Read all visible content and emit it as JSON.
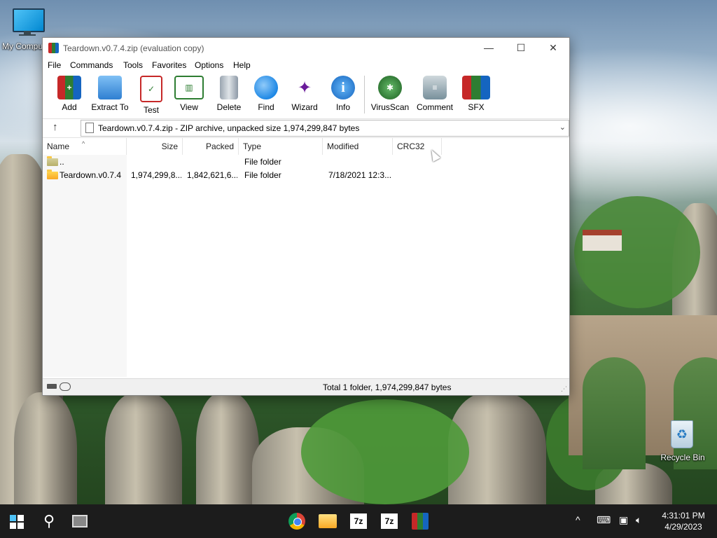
{
  "desktop": {
    "icons": [
      {
        "label": "My Compu"
      },
      {
        "label": "Recycle Bin"
      }
    ]
  },
  "window": {
    "title": "Teardown.v0.7.4.zip (evaluation copy)",
    "controls": {
      "minimize": "—",
      "maximize": "☐",
      "close": "✕"
    },
    "menu": [
      "File",
      "Commands",
      "Tools",
      "Favorites",
      "Options",
      "Help"
    ],
    "toolbar": [
      {
        "label": "Add",
        "icon": "add-archive-icon",
        "color": "#b71c1c"
      },
      {
        "label": "Extract To",
        "icon": "extract-folder-icon",
        "color": "#2f7fd1"
      },
      {
        "label": "Test",
        "icon": "test-checklist-icon",
        "color": "#c62828"
      },
      {
        "label": "View",
        "icon": "view-book-icon",
        "color": "#2e7d32"
      },
      {
        "label": "Delete",
        "icon": "trash-icon",
        "color": "#8d99a6"
      },
      {
        "label": "Find",
        "icon": "magnifier-icon",
        "color": "#1e88e5"
      },
      {
        "label": "Wizard",
        "icon": "magic-wand-icon",
        "color": "#7e57c2"
      },
      {
        "label": "Info",
        "icon": "info-icon",
        "color": "#1565c0"
      },
      {
        "label": "VirusScan",
        "icon": "virus-scan-icon",
        "color": "#2e7d32"
      },
      {
        "label": "Comment",
        "icon": "comment-icon",
        "color": "#78909c"
      },
      {
        "label": "SFX",
        "icon": "sfx-archive-icon",
        "color": "#c62828"
      }
    ],
    "address": "Teardown.v0.7.4.zip - ZIP archive, unpacked size 1,974,299,847 bytes",
    "columns": [
      "Name",
      "Size",
      "Packed",
      "Type",
      "Modified",
      "CRC32"
    ],
    "rows": [
      {
        "name": "..",
        "size": "",
        "packed": "",
        "type": "File folder",
        "modified": "",
        "crc": ""
      },
      {
        "name": "Teardown.v0.7.4",
        "size": "1,974,299,8...",
        "packed": "1,842,621,6...",
        "type": "File folder",
        "modified": "7/18/2021 12:3...",
        "crc": ""
      }
    ],
    "status": "Total 1 folder, 1,974,299,847 bytes"
  },
  "taskbar": {
    "apps": [
      {
        "name": "chrome-icon",
        "color": "#db4437"
      },
      {
        "name": "file-explorer-icon",
        "color": "#f9c846"
      },
      {
        "name": "7zip-icon-1",
        "label": "7z"
      },
      {
        "name": "7zip-icon-2",
        "label": "7z"
      },
      {
        "name": "winrar-icon",
        "color": "#b71c1c"
      }
    ],
    "tray": {
      "chevron": "^",
      "time": "4:31:01 PM",
      "date": "4/29/2023"
    }
  }
}
